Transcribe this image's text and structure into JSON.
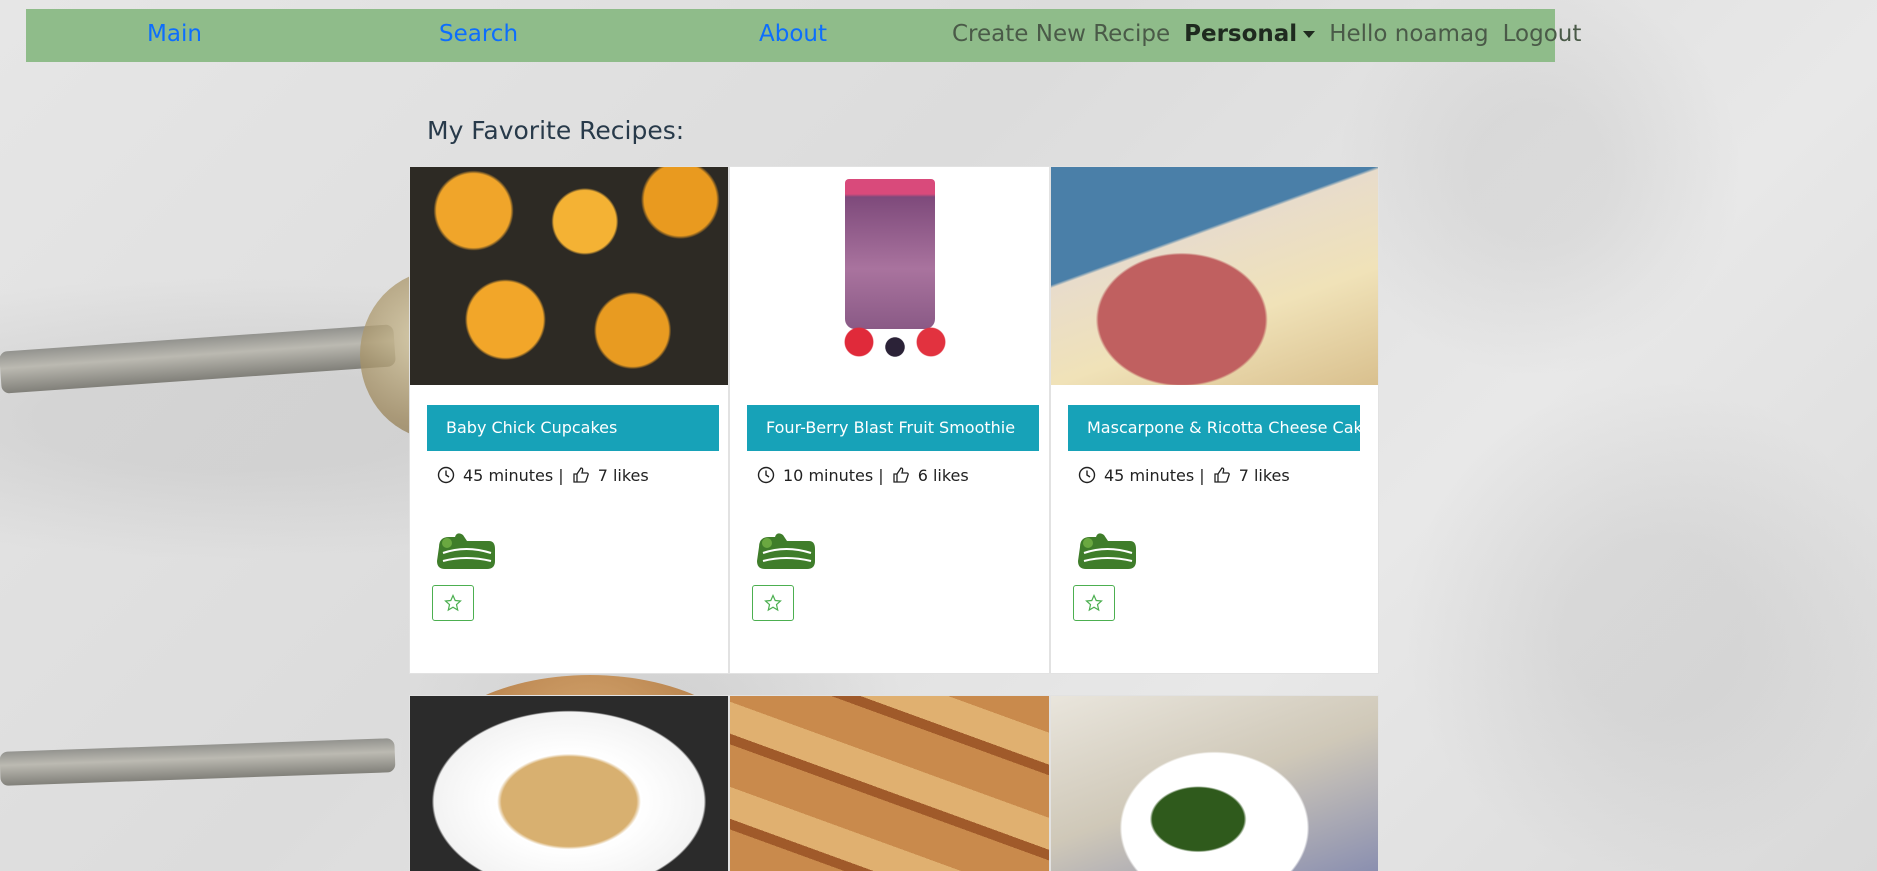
{
  "nav": {
    "main": "Main",
    "search": "Search",
    "about": "About",
    "create": "Create New Recipe",
    "personal": "Personal",
    "hello": "Hello noamag",
    "logout": "Logout"
  },
  "section_title": "My Favorite Recipes:",
  "recipes": [
    {
      "title": "Baby Chick Cupcakes",
      "time": "45 minutes |",
      "likes": "7 likes",
      "badge": "100% Vegetarian"
    },
    {
      "title": "Four-Berry Blast Fruit Smoothie",
      "time": "10 minutes |",
      "likes": "6 likes",
      "badge": "100% Vegetarian"
    },
    {
      "title": "Mascarpone & Ricotta Cheese Cake",
      "time": "45 minutes |",
      "likes": "7 likes",
      "badge": "100% Vegetarian"
    }
  ],
  "colors": {
    "navbar": "#8fbc8a",
    "link": "#0d6efd",
    "title_button": "#17a2b8",
    "fav_border": "#4caf50"
  }
}
